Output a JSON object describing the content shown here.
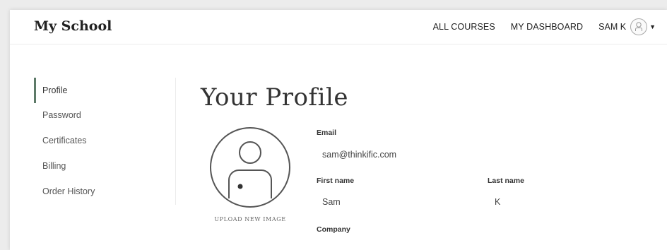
{
  "header": {
    "brand": "My School",
    "nav": [
      "ALL COURSES",
      "MY DASHBOARD"
    ],
    "user_name": "SAM K"
  },
  "sidebar": {
    "items": [
      {
        "label": "Profile",
        "active": true
      },
      {
        "label": "Password"
      },
      {
        "label": "Certificates"
      },
      {
        "label": "Billing"
      },
      {
        "label": "Order History"
      }
    ]
  },
  "profile": {
    "title": "Your Profile",
    "upload_label": "UPLOAD NEW IMAGE",
    "email_label": "Email",
    "email_value": "sam@thinkific.com",
    "first_name_label": "First name",
    "first_name_value": "Sam",
    "last_name_label": "Last name",
    "last_name_value": "K",
    "company_label": "Company"
  },
  "colors": {
    "accent": "#5d7a68",
    "background": "#ececec"
  }
}
